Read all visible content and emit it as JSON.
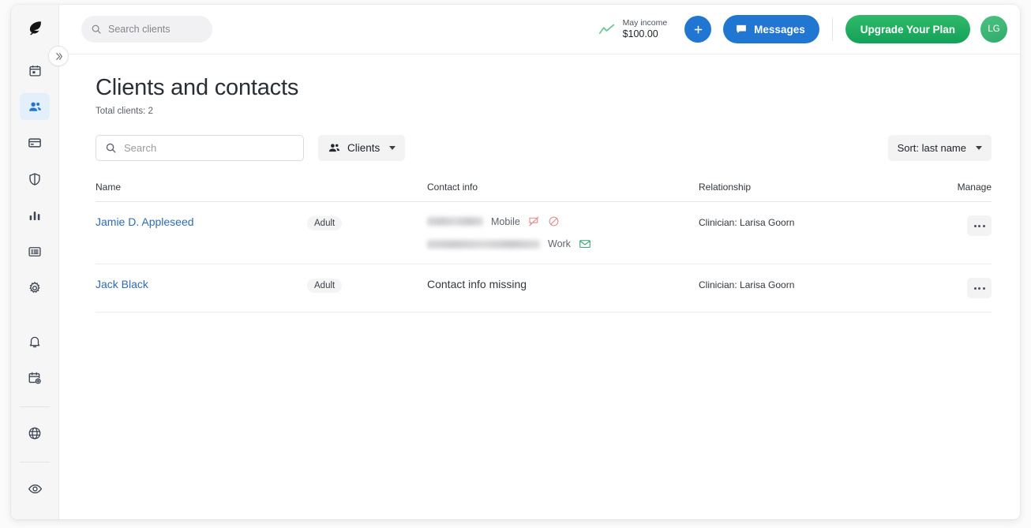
{
  "app": {
    "brand_icon": "leaf-logo-icon",
    "collapse_icon": "chevron-double-right-icon"
  },
  "sidebar": {
    "primary_items": [
      {
        "icon": "calendar-icon",
        "name": "sidebar-item-calendar",
        "active": false
      },
      {
        "icon": "people-icon",
        "name": "sidebar-item-clients",
        "active": true
      },
      {
        "icon": "credit-card-icon",
        "name": "sidebar-item-billing",
        "active": false
      },
      {
        "icon": "shield-icon",
        "name": "sidebar-item-insurance",
        "active": false
      },
      {
        "icon": "bar-chart-icon",
        "name": "sidebar-item-analytics",
        "active": false
      },
      {
        "icon": "list-icon",
        "name": "sidebar-item-notes",
        "active": false
      },
      {
        "icon": "gear-icon",
        "name": "sidebar-item-settings",
        "active": false
      }
    ],
    "secondary_items": [
      {
        "icon": "bell-icon",
        "name": "sidebar-item-notifications"
      },
      {
        "icon": "calendar-add-icon",
        "name": "sidebar-item-scheduling"
      }
    ],
    "tertiary_items": [
      {
        "icon": "globe-icon",
        "name": "sidebar-item-website"
      }
    ],
    "quaternary_items": [
      {
        "icon": "eye-icon",
        "name": "sidebar-item-preview"
      }
    ]
  },
  "topbar": {
    "search_placeholder": "Search clients",
    "search_icon": "search-icon",
    "income_label": "May income",
    "income_value": "$100.00",
    "income_icon": "trend-line-icon",
    "add_label": "+",
    "add_icon": "plus-icon",
    "messages_label": "Messages",
    "messages_icon": "chat-bubble-icon",
    "upgrade_label": "Upgrade Your Plan",
    "avatar_initials": "LG"
  },
  "page": {
    "title": "Clients and contacts",
    "total_clients": "Total clients: 2"
  },
  "toolbar": {
    "search_placeholder": "Search",
    "search_icon": "search-icon",
    "filter_label": "Clients",
    "filter_icon": "people-icon",
    "sort_label": "Sort: last name"
  },
  "table": {
    "headers": {
      "name": "Name",
      "type": "",
      "contact": "Contact info",
      "relationship": "Relationship",
      "manage": "Manage"
    },
    "rows": [
      {
        "name": "Jamie D. Appleseed",
        "type": "Adult",
        "contact_missing": "",
        "contacts": [
          {
            "redacted": "phone",
            "label": "Mobile",
            "icons": [
              "no-sms-icon",
              "no-calls-icon"
            ]
          },
          {
            "redacted": "email",
            "label": "Work",
            "icons": [
              "email-icon"
            ]
          }
        ],
        "relationship": "Clinician: Larisa Goorn",
        "manage_icon": "ellipsis-icon"
      },
      {
        "name": "Jack Black",
        "type": "Adult",
        "contact_missing": "Contact info missing",
        "contacts": [],
        "relationship": "Clinician: Larisa Goorn",
        "manage_icon": "ellipsis-icon"
      }
    ]
  },
  "colors": {
    "accent_blue": "#2176d2",
    "link_blue": "#2c6cb5",
    "upgrade_green": "#12a259",
    "avatar_green": "#2eab6b",
    "danger_red": "#e08a8a",
    "email_green": "#2f9e6e",
    "sidebar_bg": "#f6f6f7",
    "active_nav_bg": "#e4effc"
  }
}
